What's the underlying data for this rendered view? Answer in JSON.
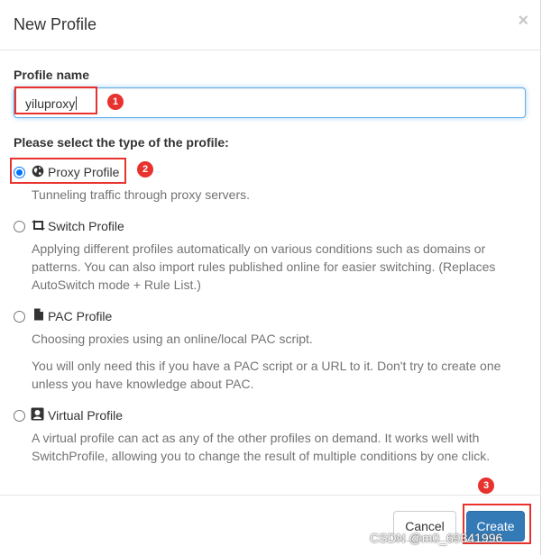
{
  "dialog": {
    "title": "New Profile",
    "close_glyph": "×"
  },
  "form": {
    "name_label": "Profile name",
    "name_value": "yiluproxy",
    "type_label": "Please select the type of the profile:"
  },
  "options": [
    {
      "label": "Proxy Profile",
      "icon": "globe-icon",
      "checked": true,
      "help": [
        "Tunneling traffic through proxy servers."
      ]
    },
    {
      "label": "Switch Profile",
      "icon": "retweet-icon",
      "checked": false,
      "help": [
        "Applying different profiles automatically on various conditions such as domains or patterns. You can also import rules published online for easier switching. (Replaces AutoSwitch mode + Rule List.)"
      ]
    },
    {
      "label": "PAC Profile",
      "icon": "file-icon",
      "checked": false,
      "help": [
        "Choosing proxies using an online/local PAC script.",
        "You will only need this if you have a PAC script or a URL to it. Don't try to create one unless you have knowledge about PAC."
      ]
    },
    {
      "label": "Virtual Profile",
      "icon": "virtual-profile-icon",
      "checked": false,
      "help": [
        "A virtual profile can act as any of the other profiles on demand. It works well with SwitchProfile, allowing you to change the result of multiple conditions by one click."
      ]
    }
  ],
  "buttons": {
    "cancel": "Cancel",
    "create": "Create"
  },
  "annotations": [
    "1",
    "2",
    "3"
  ],
  "watermark": "CSDN @m0_69341996",
  "colors": {
    "annotation": "#e8322e",
    "primary_button": "#337ab7",
    "radio_checked": "#0075ff",
    "input_focus": "#66afe9"
  }
}
